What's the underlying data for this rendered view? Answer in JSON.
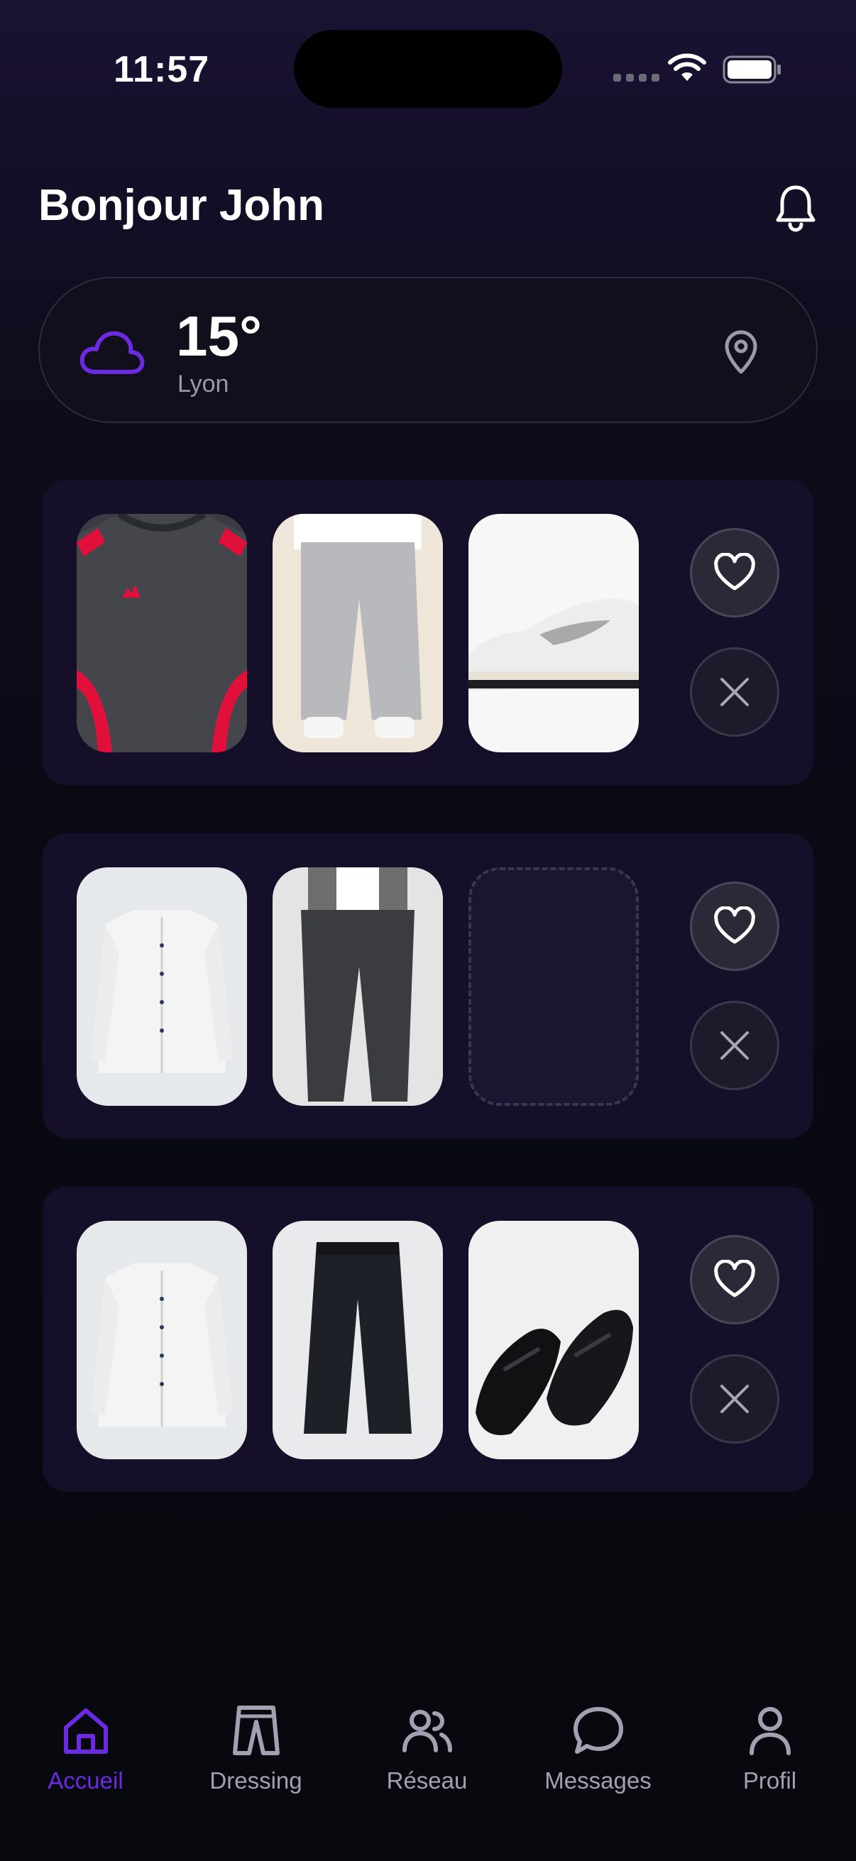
{
  "status_bar": {
    "time": "11:57"
  },
  "header": {
    "greeting": "Bonjour John"
  },
  "weather": {
    "temperature": "15°",
    "city": "Lyon",
    "icon": "cloud-icon"
  },
  "outfits": [
    {
      "items": [
        "grey-sport-tshirt",
        "grey-joggers",
        "white-sneakers"
      ]
    },
    {
      "items": [
        "white-shirt",
        "dark-jeans",
        "empty-slot"
      ]
    },
    {
      "items": [
        "white-shirt",
        "black-trousers",
        "black-loafers"
      ]
    }
  ],
  "bottom_nav": {
    "items": [
      {
        "label": "Accueil",
        "icon": "home-icon",
        "active": true
      },
      {
        "label": "Dressing",
        "icon": "pants-icon",
        "active": false
      },
      {
        "label": "Réseau",
        "icon": "users-icon",
        "active": false
      },
      {
        "label": "Messages",
        "icon": "chat-icon",
        "active": false
      },
      {
        "label": "Profil",
        "icon": "user-icon",
        "active": false
      }
    ]
  },
  "colors": {
    "accent": "#6c2be2",
    "card": "#150f2a",
    "background": "#07070d",
    "muted": "#a1a1b2"
  }
}
